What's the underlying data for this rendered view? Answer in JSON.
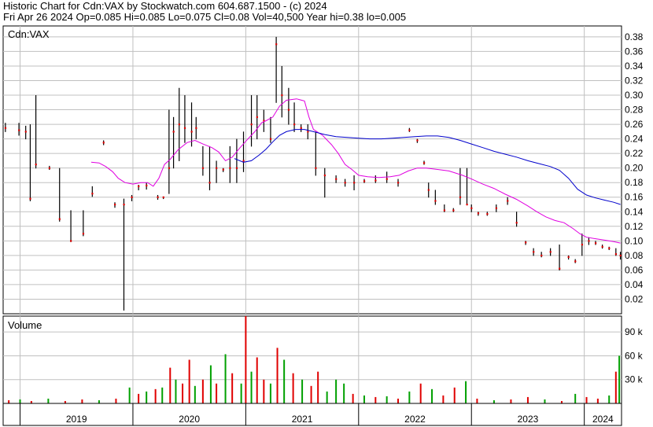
{
  "header": {
    "line1": "Historic Chart for Cdn:VAX by Stockwatch.com 604.687.1500 - (c) 2024",
    "line2": "Fri Apr 26 2024   Op=0.085  Hi=0.085  Lo=0.075  Cl=0.08  Vol=40,500  Year hi=0.38  lo=0.005"
  },
  "price_panel_label": "Cdn:VAX",
  "volume_panel_label": "Volume",
  "colors": {
    "background": "#ffffff",
    "grid": "#c0c0c0",
    "price_bar": "#000000",
    "close_tick": "#e00000",
    "ma_short": "#e000e0",
    "ma_long": "#0000cc",
    "volume_up": "#00a000",
    "volume_down": "#e00000"
  },
  "chart_data": [
    {
      "type": "line",
      "title": "",
      "series": [
        {
          "name": "",
          "values": []
        },
        {
          "name": "",
          "values": []
        }
      ],
      "x_tick_labels": [
        "2019",
        "2020",
        "2021",
        "2022",
        "2023",
        "2024"
      ],
      "x_tick_positions_years": [
        2019.0,
        2020.0,
        2021.0,
        2022.0,
        2023.0,
        2024.0
      ],
      "xlim": [
        2018.85,
        2024.33
      ],
      "y_tick_labels": [
        "0.02",
        "0.04",
        "0.06",
        "0.08",
        "0.10",
        "0.12",
        "0.14",
        "0.16",
        "0.18",
        "0.20",
        "0.22",
        "0.24",
        "0.26",
        "0.28",
        "0.30",
        "0.32",
        "0.34",
        "0.36",
        "0.38"
      ],
      "ylim": [
        0.0,
        0.395
      ],
      "grid": true,
      "price_bars": [
        [
          2018.87,
          0.262,
          0.25,
          0.255
        ],
        [
          2018.99,
          0.262,
          0.245,
          0.252
        ],
        [
          2019.05,
          0.258,
          0.24,
          0.25
        ],
        [
          2019.09,
          0.26,
          0.155,
          0.158
        ],
        [
          2019.14,
          0.3,
          0.2,
          0.205
        ],
        [
          2019.26,
          0.203,
          0.198,
          0.2
        ],
        [
          2019.35,
          0.2,
          0.127,
          0.13
        ],
        [
          2019.45,
          0.142,
          0.099,
          0.1
        ],
        [
          2019.56,
          0.142,
          0.107,
          0.11
        ],
        [
          2019.64,
          0.175,
          0.161,
          0.165
        ],
        [
          2019.74,
          0.238,
          0.232,
          0.235
        ],
        [
          2019.84,
          0.153,
          0.146,
          0.15
        ],
        [
          2019.92,
          0.158,
          0.005,
          0.15
        ],
        [
          2019.99,
          0.163,
          0.155,
          0.16
        ],
        [
          2020.05,
          0.177,
          0.17,
          0.175
        ],
        [
          2020.12,
          0.18,
          0.171,
          0.176
        ],
        [
          2020.22,
          0.163,
          0.157,
          0.16
        ],
        [
          2020.27,
          0.16,
          0.158,
          0.16
        ],
        [
          2020.32,
          0.28,
          0.165,
          0.2
        ],
        [
          2020.36,
          0.27,
          0.2,
          0.25
        ],
        [
          2020.41,
          0.31,
          0.21,
          0.26
        ],
        [
          2020.46,
          0.3,
          0.235,
          0.255
        ],
        [
          2020.52,
          0.29,
          0.23,
          0.25
        ],
        [
          2020.56,
          0.27,
          0.24,
          0.255
        ],
        [
          2020.62,
          0.23,
          0.19,
          0.2
        ],
        [
          2020.68,
          0.23,
          0.17,
          0.18
        ],
        [
          2020.74,
          0.21,
          0.18,
          0.2
        ],
        [
          2020.8,
          0.2,
          0.195,
          0.198
        ],
        [
          2020.86,
          0.23,
          0.18,
          0.2
        ],
        [
          2020.92,
          0.24,
          0.18,
          0.2
        ],
        [
          2020.98,
          0.25,
          0.195,
          0.21
        ],
        [
          2021.05,
          0.3,
          0.23,
          0.26
        ],
        [
          2021.1,
          0.3,
          0.24,
          0.27
        ],
        [
          2021.16,
          0.28,
          0.25,
          0.265
        ],
        [
          2021.22,
          0.27,
          0.235,
          0.24
        ],
        [
          2021.27,
          0.38,
          0.29,
          0.37
        ],
        [
          2021.32,
          0.34,
          0.27,
          0.3
        ],
        [
          2021.38,
          0.31,
          0.26,
          0.28
        ],
        [
          2021.43,
          0.29,
          0.25,
          0.26
        ],
        [
          2021.49,
          0.26,
          0.25,
          0.255
        ],
        [
          2021.55,
          0.26,
          0.24,
          0.25
        ],
        [
          2021.62,
          0.25,
          0.19,
          0.2
        ],
        [
          2021.7,
          0.2,
          0.16,
          0.19
        ],
        [
          2021.8,
          0.19,
          0.18,
          0.185
        ],
        [
          2021.88,
          0.185,
          0.175,
          0.18
        ],
        [
          2021.96,
          0.19,
          0.17,
          0.18
        ],
        [
          2022.05,
          0.185,
          0.18,
          0.182
        ],
        [
          2022.15,
          0.19,
          0.18,
          0.183
        ],
        [
          2022.25,
          0.195,
          0.18,
          0.185
        ],
        [
          2022.35,
          0.185,
          0.175,
          0.18
        ],
        [
          2022.45,
          0.255,
          0.25,
          0.252
        ],
        [
          2022.52,
          0.24,
          0.235,
          0.238
        ],
        [
          2022.58,
          0.21,
          0.205,
          0.207
        ],
        [
          2022.62,
          0.18,
          0.16,
          0.17
        ],
        [
          2022.68,
          0.17,
          0.15,
          0.155
        ],
        [
          2022.76,
          0.15,
          0.14,
          0.142
        ],
        [
          2022.84,
          0.145,
          0.14,
          0.142
        ],
        [
          2022.9,
          0.2,
          0.15,
          0.16
        ],
        [
          2022.96,
          0.2,
          0.15,
          0.15
        ],
        [
          2023.0,
          0.15,
          0.14,
          0.145
        ],
        [
          2023.06,
          0.14,
          0.135,
          0.138
        ],
        [
          2023.14,
          0.14,
          0.135,
          0.137
        ],
        [
          2023.22,
          0.15,
          0.14,
          0.145
        ],
        [
          2023.32,
          0.16,
          0.15,
          0.155
        ],
        [
          2023.4,
          0.14,
          0.12,
          0.125
        ],
        [
          2023.48,
          0.1,
          0.095,
          0.098
        ],
        [
          2023.55,
          0.09,
          0.08,
          0.085
        ],
        [
          2023.62,
          0.085,
          0.078,
          0.08
        ],
        [
          2023.7,
          0.09,
          0.08,
          0.085
        ],
        [
          2023.78,
          0.095,
          0.06,
          0.062
        ],
        [
          2023.86,
          0.08,
          0.075,
          0.078
        ],
        [
          2023.92,
          0.075,
          0.07,
          0.072
        ],
        [
          2023.98,
          0.11,
          0.08,
          0.095
        ],
        [
          2024.04,
          0.105,
          0.095,
          0.1
        ],
        [
          2024.1,
          0.1,
          0.095,
          0.097
        ],
        [
          2024.16,
          0.095,
          0.09,
          0.092
        ],
        [
          2024.22,
          0.092,
          0.088,
          0.09
        ],
        [
          2024.28,
          0.09,
          0.08,
          0.082
        ],
        [
          2024.32,
          0.085,
          0.075,
          0.08
        ]
      ],
      "moving_average_short": [
        [
          2019.63,
          0.208
        ],
        [
          2019.7,
          0.207
        ],
        [
          2019.76,
          0.202
        ],
        [
          2019.82,
          0.195
        ],
        [
          2019.87,
          0.186
        ],
        [
          2019.93,
          0.18
        ],
        [
          2020.0,
          0.178
        ],
        [
          2020.07,
          0.18
        ],
        [
          2020.13,
          0.18
        ],
        [
          2020.18,
          0.175
        ],
        [
          2020.23,
          0.186
        ],
        [
          2020.28,
          0.205
        ],
        [
          2020.33,
          0.212
        ],
        [
          2020.4,
          0.225
        ],
        [
          2020.48,
          0.235
        ],
        [
          2020.55,
          0.238
        ],
        [
          2020.62,
          0.233
        ],
        [
          2020.7,
          0.228
        ],
        [
          2020.76,
          0.222
        ],
        [
          2020.82,
          0.21
        ],
        [
          2020.88,
          0.215
        ],
        [
          2020.95,
          0.228
        ],
        [
          2021.02,
          0.24
        ],
        [
          2021.08,
          0.25
        ],
        [
          2021.14,
          0.262
        ],
        [
          2021.18,
          0.265
        ],
        [
          2021.24,
          0.27
        ],
        [
          2021.3,
          0.285
        ],
        [
          2021.36,
          0.293
        ],
        [
          2021.45,
          0.295
        ],
        [
          2021.52,
          0.292
        ],
        [
          2021.56,
          0.27
        ],
        [
          2021.6,
          0.253
        ],
        [
          2021.68,
          0.245
        ],
        [
          2021.76,
          0.232
        ],
        [
          2021.82,
          0.22
        ],
        [
          2021.88,
          0.205
        ],
        [
          2021.94,
          0.198
        ],
        [
          2022.0,
          0.19
        ],
        [
          2022.08,
          0.188
        ],
        [
          2022.18,
          0.187
        ],
        [
          2022.28,
          0.188
        ],
        [
          2022.36,
          0.19
        ],
        [
          2022.44,
          0.196
        ],
        [
          2022.52,
          0.2
        ],
        [
          2022.6,
          0.2
        ],
        [
          2022.7,
          0.198
        ],
        [
          2022.8,
          0.196
        ],
        [
          2022.92,
          0.19
        ],
        [
          2023.0,
          0.185
        ],
        [
          2023.1,
          0.178
        ],
        [
          2023.2,
          0.172
        ],
        [
          2023.3,
          0.164
        ],
        [
          2023.4,
          0.157
        ],
        [
          2023.5,
          0.148
        ],
        [
          2023.58,
          0.14
        ],
        [
          2023.66,
          0.133
        ],
        [
          2023.74,
          0.128
        ],
        [
          2023.82,
          0.125
        ],
        [
          2023.9,
          0.117
        ],
        [
          2023.96,
          0.11
        ],
        [
          2024.02,
          0.105
        ],
        [
          2024.1,
          0.103
        ],
        [
          2024.18,
          0.101
        ],
        [
          2024.26,
          0.099
        ],
        [
          2024.32,
          0.097
        ]
      ],
      "moving_average_long": [
        [
          2020.9,
          0.213
        ],
        [
          2020.98,
          0.208
        ],
        [
          2021.05,
          0.21
        ],
        [
          2021.12,
          0.218
        ],
        [
          2021.18,
          0.226
        ],
        [
          2021.24,
          0.236
        ],
        [
          2021.3,
          0.245
        ],
        [
          2021.36,
          0.25
        ],
        [
          2021.44,
          0.253
        ],
        [
          2021.52,
          0.253
        ],
        [
          2021.6,
          0.25
        ],
        [
          2021.7,
          0.246
        ],
        [
          2021.8,
          0.243
        ],
        [
          2021.9,
          0.242
        ],
        [
          2022.0,
          0.241
        ],
        [
          2022.1,
          0.24
        ],
        [
          2022.2,
          0.24
        ],
        [
          2022.3,
          0.241
        ],
        [
          2022.4,
          0.242
        ],
        [
          2022.5,
          0.243
        ],
        [
          2022.6,
          0.244
        ],
        [
          2022.7,
          0.244
        ],
        [
          2022.8,
          0.242
        ],
        [
          2022.9,
          0.238
        ],
        [
          2023.0,
          0.233
        ],
        [
          2023.1,
          0.228
        ],
        [
          2023.2,
          0.223
        ],
        [
          2023.3,
          0.219
        ],
        [
          2023.4,
          0.215
        ],
        [
          2023.5,
          0.21
        ],
        [
          2023.6,
          0.206
        ],
        [
          2023.7,
          0.202
        ],
        [
          2023.78,
          0.197
        ],
        [
          2023.86,
          0.186
        ],
        [
          2023.94,
          0.171
        ],
        [
          2024.02,
          0.163
        ],
        [
          2024.1,
          0.159
        ],
        [
          2024.18,
          0.156
        ],
        [
          2024.26,
          0.153
        ],
        [
          2024.32,
          0.15
        ]
      ]
    },
    {
      "type": "bar",
      "title": "",
      "y_tick_labels": [
        "30 k",
        "60 k",
        "90 k"
      ],
      "ylim": [
        0,
        110000
      ],
      "grid": true,
      "volume_bars": [
        [
          2018.9,
          4000,
          "down"
        ],
        [
          2019.0,
          5000,
          "up"
        ],
        [
          2019.1,
          3000,
          "down"
        ],
        [
          2019.25,
          6000,
          "up"
        ],
        [
          2019.4,
          3000,
          "down"
        ],
        [
          2019.55,
          5000,
          "down"
        ],
        [
          2019.7,
          4000,
          "up"
        ],
        [
          2019.85,
          6000,
          "down"
        ],
        [
          2019.97,
          20000,
          "up"
        ],
        [
          2020.05,
          12000,
          "down"
        ],
        [
          2020.12,
          15000,
          "up"
        ],
        [
          2020.2,
          18000,
          "down"
        ],
        [
          2020.26,
          20000,
          "up"
        ],
        [
          2020.33,
          45000,
          "down"
        ],
        [
          2020.38,
          30000,
          "up"
        ],
        [
          2020.44,
          25000,
          "down"
        ],
        [
          2020.5,
          55000,
          "down"
        ],
        [
          2020.55,
          22000,
          "up"
        ],
        [
          2020.62,
          30000,
          "down"
        ],
        [
          2020.69,
          48000,
          "up"
        ],
        [
          2020.74,
          25000,
          "down"
        ],
        [
          2020.82,
          62000,
          "up"
        ],
        [
          2020.88,
          38000,
          "down"
        ],
        [
          2020.96,
          25000,
          "up"
        ],
        [
          2021.0,
          110000,
          "down"
        ],
        [
          2021.05,
          40000,
          "up"
        ],
        [
          2021.1,
          58000,
          "down"
        ],
        [
          2021.16,
          30000,
          "down"
        ],
        [
          2021.22,
          25000,
          "up"
        ],
        [
          2021.28,
          70000,
          "down"
        ],
        [
          2021.34,
          55000,
          "up"
        ],
        [
          2021.42,
          38000,
          "down"
        ],
        [
          2021.5,
          30000,
          "up"
        ],
        [
          2021.58,
          22000,
          "down"
        ],
        [
          2021.64,
          40000,
          "down"
        ],
        [
          2021.72,
          15000,
          "up"
        ],
        [
          2021.8,
          30000,
          "up"
        ],
        [
          2021.87,
          25000,
          "up"
        ],
        [
          2021.95,
          12000,
          "down"
        ],
        [
          2022.05,
          10000,
          "up"
        ],
        [
          2022.15,
          8000,
          "down"
        ],
        [
          2022.25,
          9000,
          "up"
        ],
        [
          2022.35,
          6000,
          "down"
        ],
        [
          2022.45,
          15000,
          "up"
        ],
        [
          2022.55,
          25000,
          "down"
        ],
        [
          2022.65,
          18000,
          "up"
        ],
        [
          2022.75,
          10000,
          "down"
        ],
        [
          2022.85,
          20000,
          "down"
        ],
        [
          2022.95,
          28000,
          "up"
        ],
        [
          2023.05,
          6000,
          "down"
        ],
        [
          2023.2,
          4000,
          "up"
        ],
        [
          2023.35,
          5000,
          "down"
        ],
        [
          2023.5,
          8000,
          "down"
        ],
        [
          2023.65,
          5000,
          "up"
        ],
        [
          2023.8,
          3000,
          "down"
        ],
        [
          2023.92,
          12000,
          "up"
        ],
        [
          2024.02,
          8000,
          "down"
        ],
        [
          2024.12,
          6000,
          "down"
        ],
        [
          2024.22,
          10000,
          "up"
        ],
        [
          2024.28,
          40000,
          "down"
        ],
        [
          2024.31,
          60000,
          "up"
        ]
      ]
    }
  ]
}
